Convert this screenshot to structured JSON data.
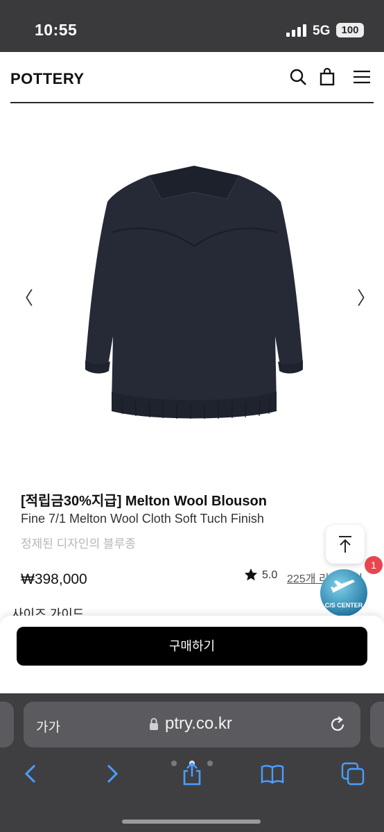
{
  "status": {
    "time": "10:55",
    "network": "5G",
    "battery": "100"
  },
  "header": {
    "logo": "POTTERY",
    "icons": [
      "search-icon",
      "bag-icon",
      "menu-icon"
    ]
  },
  "product": {
    "title": "[적립금30%지급] Melton Wool Blouson",
    "subtitle": "Fine 7/1 Melton Wool Cloth Soft Tuch Finish",
    "description": "정제된 디자인의 블루종",
    "price": "₩398,000",
    "rating": "5.0",
    "review_link": "225개 리뷰 보기",
    "size_guide": "사이즈 가이드",
    "jacket_color": "#262a36"
  },
  "gallery": {
    "prev": "〈",
    "next": "〉"
  },
  "cs_center": {
    "label": "C/S CENTER",
    "badge": "1"
  },
  "buy": {
    "label": "구매하기"
  },
  "browser": {
    "aa": "가가",
    "url": "ptry.co.kr"
  },
  "colors": {
    "status_bar": "#3a3a3c",
    "browser_bar": "#3f3f42",
    "url_pill": "#5b5b5f",
    "toolbar_accent": "#4a9fff",
    "badge": "#e8464f"
  }
}
